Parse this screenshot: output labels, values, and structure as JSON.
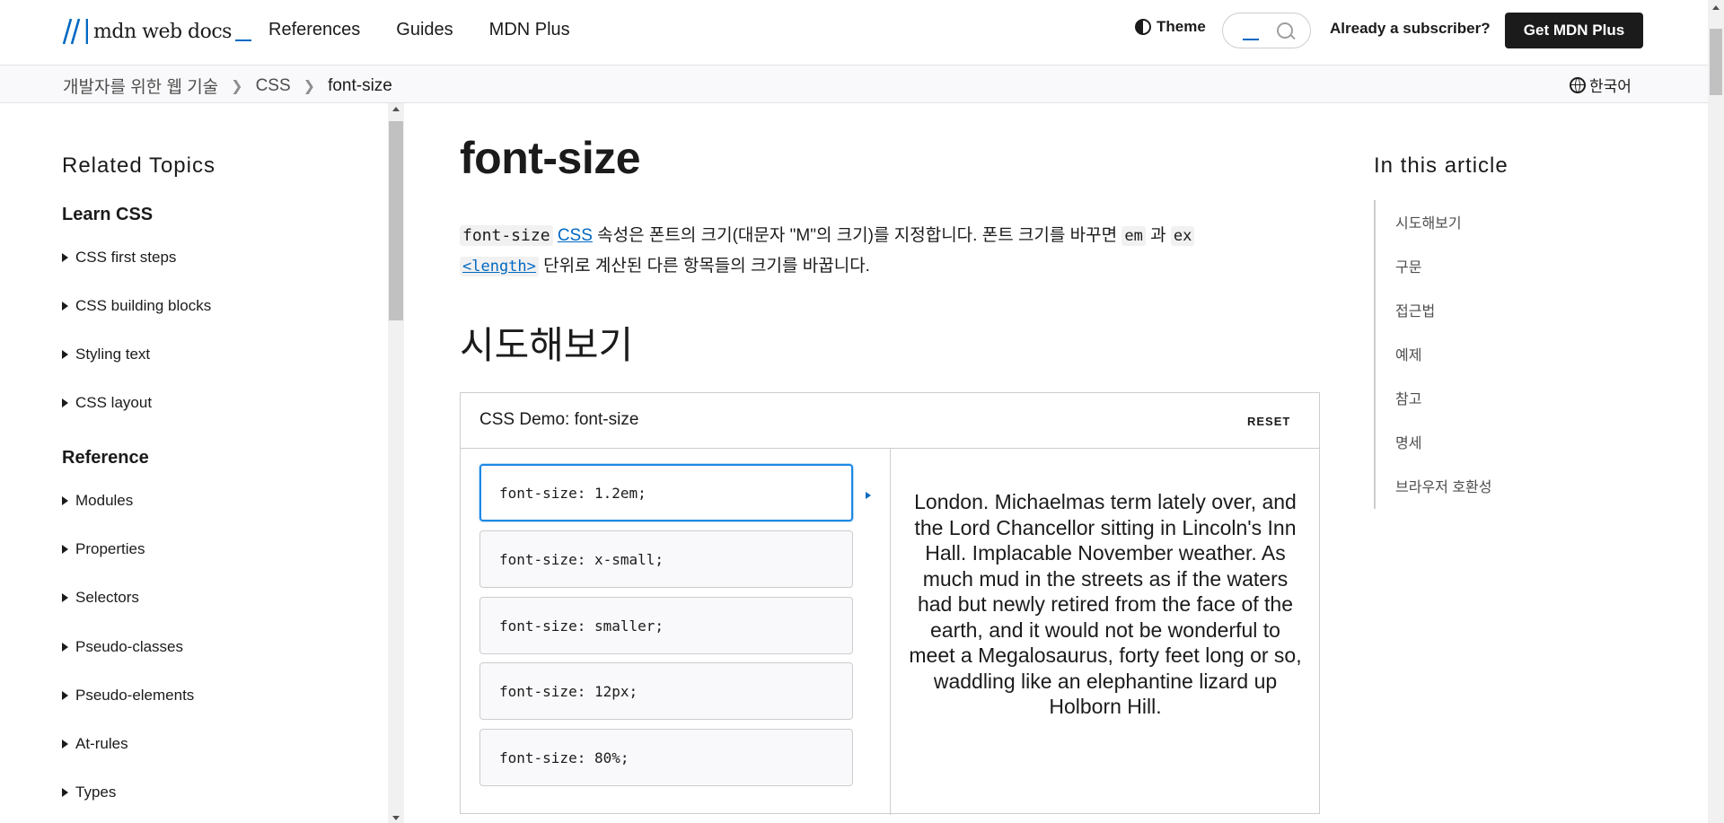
{
  "header": {
    "logo_text": "mdn web docs",
    "nav": [
      "References",
      "Guides",
      "MDN Plus"
    ],
    "theme_label": "Theme",
    "subscriber_label": "Already a subscriber?",
    "cta_label": "Get MDN Plus"
  },
  "breadcrumb": {
    "items": [
      "개발자를 위한 웹 기술",
      "CSS",
      "font-size"
    ],
    "language": "한국어"
  },
  "sidebar": {
    "title": "Related Topics",
    "sections": [
      {
        "heading": "Learn CSS",
        "items": [
          "CSS first steps",
          "CSS building blocks",
          "Styling text",
          "CSS layout"
        ]
      },
      {
        "heading": "Reference",
        "items": [
          "Modules",
          "Properties",
          "Selectors",
          "Pseudo-classes",
          "Pseudo-elements",
          "At-rules",
          "Types"
        ]
      }
    ]
  },
  "main": {
    "title": "font-size",
    "intro": {
      "code_property": "font-size",
      "css_link": "CSS",
      "text1": " 속성은 폰트의 크기(대문자 \"M\"의 크기)를 지정합니다. 폰트 크기를 바꾸면 ",
      "code_em": "em",
      "text_and": " 과 ",
      "code_ex": "ex",
      "length_link": "<length>",
      "text2": " 단위로 계산된 다른 항목들의 크기를 바꿉니다."
    },
    "section_title": "시도해보기",
    "demo": {
      "title": "CSS Demo: font-size",
      "reset_label": "RESET",
      "options": [
        "font-size: 1.2em;",
        "font-size: x-small;",
        "font-size: smaller;",
        "font-size: 12px;",
        "font-size: 80%;"
      ],
      "selected_index": 0,
      "output_text": "London. Michaelmas term lately over, and the Lord Chancellor sitting in Lincoln's Inn Hall. Implacable November weather. As much mud in the streets as if the waters had but newly retired from the face of the earth, and it would not be wonderful to meet a Megalosaurus, forty feet long or so, waddling like an elephantine lizard up Holborn Hill."
    }
  },
  "toc": {
    "title": "In this article",
    "items": [
      "시도해보기",
      "구문",
      "접근법",
      "예제",
      "참고",
      "명세",
      "브라우저 호환성"
    ]
  },
  "colors": {
    "accent": "#0069c2",
    "selected_border": "#1e88e5",
    "cta_bg": "#1b1b1b"
  }
}
